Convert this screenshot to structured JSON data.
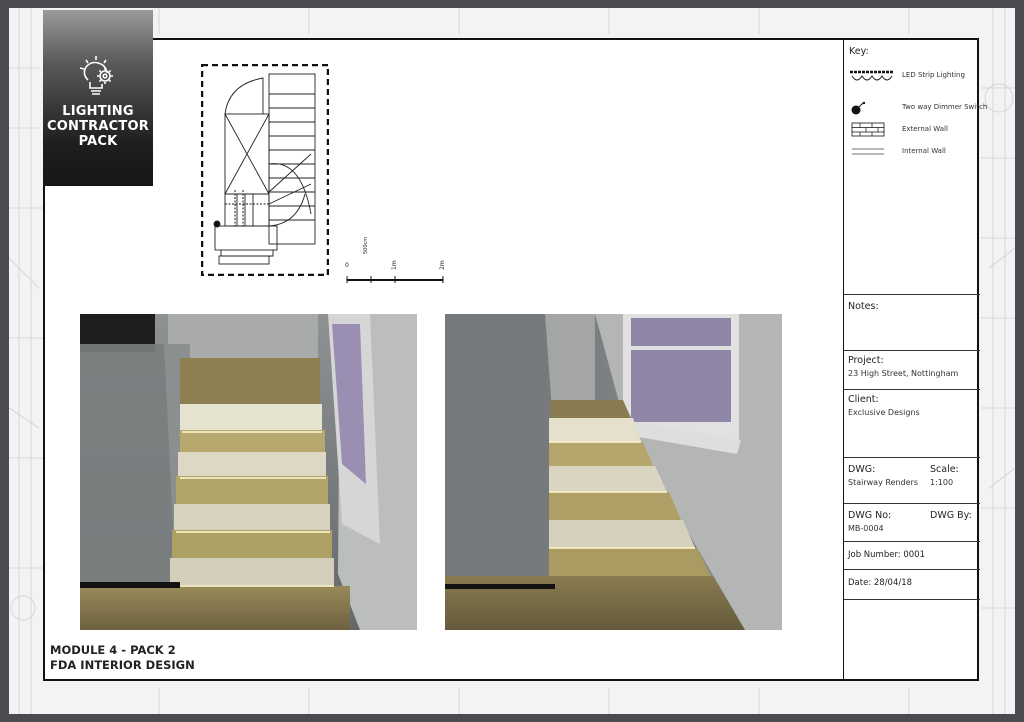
{
  "badge": {
    "icon": "lightbulb-gear-icon",
    "lines": [
      "LIGHTING",
      "CONTRACTOR",
      "PACK"
    ]
  },
  "footer": {
    "line1": "MODULE 4 - PACK 2",
    "line2": "FDA INTERIOR DESIGN"
  },
  "plan": {
    "icon": "floor-plan-drawing"
  },
  "scale_bar": {
    "ticks": [
      "0",
      "500cm",
      "1m",
      "2m"
    ]
  },
  "renders": [
    {
      "name": "stairway-render-front",
      "icon": "stair-render-image"
    },
    {
      "name": "stairway-render-angled",
      "icon": "stair-render-image"
    }
  ],
  "title_block": {
    "key": {
      "title": "Key:",
      "items": [
        {
          "symbol": "led-strip-symbol",
          "label": "LED Strip Lighting"
        },
        {
          "symbol": "dimmer-switch-symbol",
          "label": "Two way Dimmer Switch"
        },
        {
          "symbol": "external-wall-symbol",
          "label": "External Wall"
        },
        {
          "symbol": "internal-wall-symbol",
          "label": "Internal Wall"
        }
      ]
    },
    "notes_label": "Notes:",
    "project_label": "Project:",
    "project_value": "23 High Street, Nottingham",
    "client_label": "Client:",
    "client_value": "Exclusive Designs",
    "dwg_label": "DWG:",
    "dwg_value": "Stairway Renders",
    "scale_label": "Scale:",
    "scale_value": "1:100",
    "dwg_no_label": "DWG No:",
    "dwg_no_value": "MB-0004",
    "dwg_by_label": "DWG By:",
    "job_number": "Job Number: 0001",
    "date": "Date: 28/04/18"
  }
}
